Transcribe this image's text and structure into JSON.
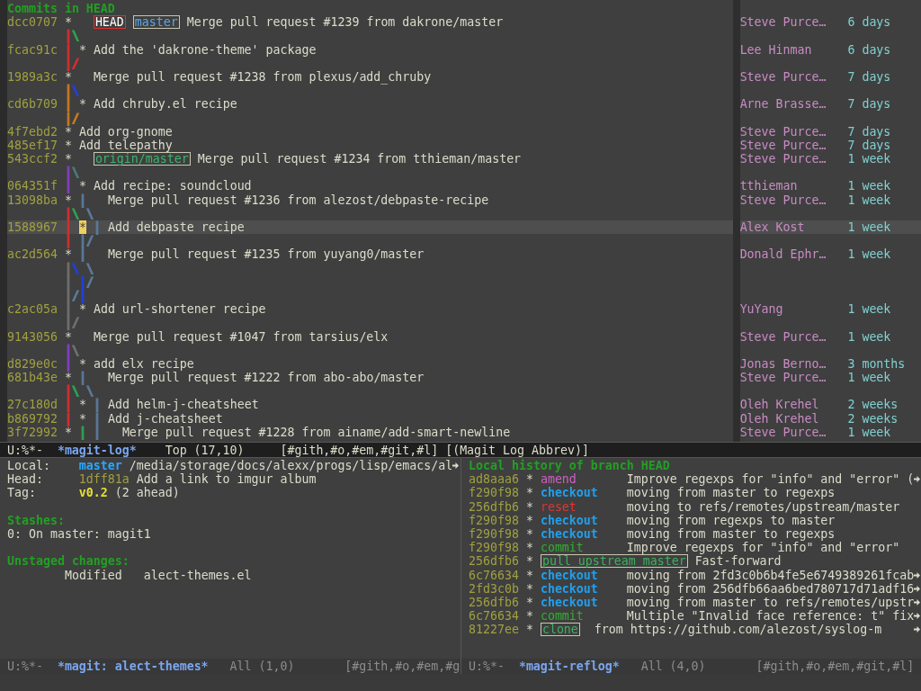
{
  "log": {
    "title": "Commits in HEAD",
    "rows": [
      {
        "kind": "commit",
        "hash": "dcc0707",
        "graph": [
          {
            "text": "*   "
          }
        ],
        "refs": [
          {
            "text": "HEAD",
            "kind": "head"
          },
          {
            "text": "master",
            "kind": "branch"
          }
        ],
        "message": "Merge pull request #1239 from dakrone/master",
        "author": "Steve Purce…",
        "date": "6 days",
        "selected": false
      },
      {
        "kind": "graph",
        "graph": [
          {
            "text": "|",
            "color": "#d03030"
          },
          {
            "text": "\\",
            "color": "#30a050"
          }
        ]
      },
      {
        "kind": "commit",
        "hash": "fcac91c",
        "graph": [
          {
            "text": "|",
            "color": "#d03030"
          },
          {
            "text": " * "
          }
        ],
        "message": "Add the 'dakrone-theme' package",
        "author": "Lee Hinman",
        "date": "6 days",
        "selected": false
      },
      {
        "kind": "graph",
        "graph": [
          {
            "text": "|",
            "color": "#d03030"
          },
          {
            "text": "/",
            "color": "#d03030"
          }
        ]
      },
      {
        "kind": "commit",
        "hash": "1989a3c",
        "graph": [
          {
            "text": "*   "
          }
        ],
        "message": "Merge pull request #1238 from plexus/add_chruby",
        "author": "Steve Purce…",
        "date": "7 days",
        "selected": false
      },
      {
        "kind": "graph",
        "graph": [
          {
            "text": "|",
            "color": "#c87820"
          },
          {
            "text": "\\",
            "color": "#2040e0"
          }
        ]
      },
      {
        "kind": "commit",
        "hash": "cd6b709",
        "graph": [
          {
            "text": "|",
            "color": "#c87820"
          },
          {
            "text": " * "
          }
        ],
        "message": "Add chruby.el recipe",
        "author": "Arne Brasse…",
        "date": "7 days",
        "selected": false
      },
      {
        "kind": "graph",
        "graph": [
          {
            "text": "|",
            "color": "#c87820"
          },
          {
            "text": "/",
            "color": "#c87820"
          }
        ]
      },
      {
        "kind": "commit",
        "hash": "4f7ebd2",
        "graph": [
          {
            "text": "* "
          }
        ],
        "message": "Add org-gnome",
        "author": "Steve Purce…",
        "date": "7 days",
        "selected": false
      },
      {
        "kind": "commit",
        "hash": "485ef17",
        "graph": [
          {
            "text": "* "
          }
        ],
        "message": "Add telepathy",
        "author": "Steve Purce…",
        "date": "7 days",
        "selected": false
      },
      {
        "kind": "commit",
        "hash": "543ccf2",
        "graph": [
          {
            "text": "*   "
          }
        ],
        "refs": [
          {
            "text": "origin/master",
            "kind": "remote"
          }
        ],
        "message": "Merge pull request #1234 from tthieman/master",
        "author": "Steve Purce…",
        "date": "1 week",
        "selected": false
      },
      {
        "kind": "graph",
        "graph": [
          {
            "text": "|",
            "color": "#8040c0"
          },
          {
            "text": "\\",
            "color": "#4a7a7a"
          }
        ]
      },
      {
        "kind": "commit",
        "hash": "064351f",
        "graph": [
          {
            "text": "|",
            "color": "#8040c0"
          },
          {
            "text": " * "
          }
        ],
        "message": "Add recipe: soundcloud",
        "author": "tthieman",
        "date": "1 week",
        "selected": false
      },
      {
        "kind": "commit",
        "hash": "13098ba",
        "graph": [
          {
            "text": "* "
          },
          {
            "text": "|   ",
            "color": "#5a7a9a"
          }
        ],
        "message": "Merge pull request #1236 from alezost/debpaste-recipe",
        "author": "Steve Purce…",
        "date": "1 week",
        "selected": false
      },
      {
        "kind": "graph",
        "graph": [
          {
            "text": "|",
            "color": "#d03030"
          },
          {
            "text": "\\ ",
            "color": "#30a050"
          },
          {
            "text": "\\",
            "color": "#5a7a9a"
          }
        ]
      },
      {
        "kind": "commit",
        "hash": "1588967",
        "graph": [
          {
            "text": "|",
            "color": "#d03030"
          },
          {
            "text": " * ",
            "cursor": true
          },
          {
            "text": "| ",
            "color": "#5a7a9a"
          }
        ],
        "message": "Add debpaste recipe",
        "author": "Alex Kost",
        "date": "1 week",
        "selected": true
      },
      {
        "kind": "graph",
        "graph": [
          {
            "text": "|",
            "color": "#d03030"
          },
          {
            "text": " |",
            "color": "#5a7a9a"
          },
          {
            "text": "/",
            "color": "#5a7a9a"
          }
        ]
      },
      {
        "kind": "commit",
        "hash": "ac2d564",
        "graph": [
          {
            "text": "* "
          },
          {
            "text": "|   ",
            "color": "#5a7a9a"
          }
        ],
        "message": "Merge pull request #1235 from yuyang0/master",
        "author": "Donald Ephr…",
        "date": "1 week",
        "selected": false
      },
      {
        "kind": "graph",
        "graph": [
          {
            "text": "|",
            "color": "#707070"
          },
          {
            "text": "\\ ",
            "color": "#2040e0"
          },
          {
            "text": "\\",
            "color": "#5a7a9a"
          }
        ]
      },
      {
        "kind": "graph",
        "graph": [
          {
            "text": "|",
            "color": "#707070"
          },
          {
            "text": " |",
            "color": "#2040e0"
          },
          {
            "text": "/",
            "color": "#5a7a9a"
          }
        ]
      },
      {
        "kind": "graph",
        "graph": [
          {
            "text": "|",
            "color": "#707070"
          },
          {
            "text": "/",
            "color": "#5a7a9a"
          },
          {
            "text": "|",
            "color": "#2040e0"
          }
        ]
      },
      {
        "kind": "commit",
        "hash": "c2ac05a",
        "graph": [
          {
            "text": "|",
            "color": "#707070"
          },
          {
            "text": " * "
          }
        ],
        "message": "Add url-shortener recipe",
        "author": "YuYang",
        "date": "1 week",
        "selected": false
      },
      {
        "kind": "graph",
        "graph": [
          {
            "text": "|",
            "color": "#707070"
          },
          {
            "text": "/",
            "color": "#707070"
          }
        ]
      },
      {
        "kind": "commit",
        "hash": "9143056",
        "graph": [
          {
            "text": "*   "
          }
        ],
        "message": "Merge pull request #1047 from tarsius/elx",
        "author": "Steve Purce…",
        "date": "1 week",
        "selected": false
      },
      {
        "kind": "graph",
        "graph": [
          {
            "text": "|",
            "color": "#8040c0"
          },
          {
            "text": "\\",
            "color": "#707070"
          }
        ]
      },
      {
        "kind": "commit",
        "hash": "d829e0c",
        "graph": [
          {
            "text": "|",
            "color": "#8040c0"
          },
          {
            "text": " * "
          }
        ],
        "message": "add elx recipe",
        "author": "Jonas Berno…",
        "date": "3 months",
        "selected": false
      },
      {
        "kind": "commit",
        "hash": "681b43e",
        "graph": [
          {
            "text": "* "
          },
          {
            "text": "|   ",
            "color": "#5a7a9a"
          }
        ],
        "message": "Merge pull request #1222 from abo-abo/master",
        "author": "Steve Purce…",
        "date": "1 week",
        "selected": false
      },
      {
        "kind": "graph",
        "graph": [
          {
            "text": "|",
            "color": "#d03030"
          },
          {
            "text": "\\ ",
            "color": "#30a050"
          },
          {
            "text": "\\",
            "color": "#5a7a9a"
          }
        ]
      },
      {
        "kind": "commit",
        "hash": "27c180d",
        "graph": [
          {
            "text": "|",
            "color": "#d03030"
          },
          {
            "text": " * "
          },
          {
            "text": "| ",
            "color": "#5a7a9a"
          }
        ],
        "message": "Add helm-j-cheatsheet",
        "author": "Oleh Krehel",
        "date": "2 weeks",
        "selected": false
      },
      {
        "kind": "commit",
        "hash": "b869792",
        "graph": [
          {
            "text": "|",
            "color": "#d03030"
          },
          {
            "text": " * "
          },
          {
            "text": "| ",
            "color": "#5a7a9a"
          }
        ],
        "message": "Add j-cheatsheet",
        "author": "Oleh Krehel",
        "date": "2 weeks",
        "selected": false
      },
      {
        "kind": "commit",
        "hash": "3f72992",
        "graph": [
          {
            "text": "* "
          },
          {
            "text": "| ",
            "color": "#30a050"
          },
          {
            "text": "|   ",
            "color": "#5a7a9a"
          }
        ],
        "message": "Merge pull request #1228 from ainame/add-smart-newline",
        "author": "Steve Purce…",
        "date": "1 week",
        "selected": false
      }
    ]
  },
  "log_mode_line": {
    "active": true,
    "segments": [
      {
        "text": "U:%*-",
        "kind": "flags"
      },
      {
        "text": "*magit-log*",
        "kind": "buffer"
      },
      {
        "text": "Top (17,10)",
        "kind": "position"
      },
      {
        "text": "[#gith,#o,#em,#git,#l]",
        "kind": "tags"
      },
      {
        "text": "[(Magit Log Abbrev)]",
        "kind": "mode"
      }
    ]
  },
  "status": {
    "fields": [
      {
        "label": "Local:",
        "value": [
          {
            "text": "master",
            "kind": "branch"
          },
          {
            "text": "/media/storage/docs/alexx/progs/lisp/emacs/al",
            "kind": "text"
          }
        ],
        "truncated": true
      },
      {
        "label": "Head:",
        "value": [
          {
            "text": "1dff81a",
            "kind": "hash"
          },
          {
            "text": "Add a link to imgur album",
            "kind": "text"
          }
        ],
        "truncated": false
      },
      {
        "label": "Tag:",
        "value": [
          {
            "text": "v0.2",
            "kind": "tag"
          },
          {
            "text": "(2 ahead)",
            "kind": "text"
          }
        ],
        "truncated": false
      }
    ],
    "sections": [
      {
        "title": "Stashes:",
        "items": [
          {
            "kind": "stash",
            "text": "0: On master: magit1"
          }
        ]
      },
      {
        "title": "Unstaged changes:",
        "items": [
          {
            "kind": "change",
            "status": "Modified",
            "file": "alect-themes.el"
          }
        ]
      }
    ]
  },
  "status_mode_line": {
    "active": false,
    "segments": [
      {
        "text": "U:%*-",
        "kind": "flags"
      },
      {
        "text": "*magit: alect-themes*",
        "kind": "buffer"
      },
      {
        "text": "All (1,0)",
        "kind": "position"
      },
      {
        "text": "[#gith,#o,#em,#g",
        "kind": "tags"
      }
    ]
  },
  "reflog": {
    "title": "Local history of branch HEAD",
    "rows": [
      {
        "hash": "ad8aaa6",
        "action": "amend",
        "kind": "amend",
        "message": "Improve regexps for \"info\" and \"error\" (",
        "truncated": true
      },
      {
        "hash": "f290f98",
        "action": "checkout",
        "kind": "checkout",
        "message": "moving from master to regexps",
        "truncated": false
      },
      {
        "hash": "256dfb6",
        "action": "reset",
        "kind": "reset",
        "message": "moving to refs/remotes/upstream/master",
        "truncated": false
      },
      {
        "hash": "f290f98",
        "action": "checkout",
        "kind": "checkout",
        "message": "moving from regexps to master",
        "truncated": false
      },
      {
        "hash": "f290f98",
        "action": "checkout",
        "kind": "checkout",
        "message": "moving from master to regexps",
        "truncated": false
      },
      {
        "hash": "f290f98",
        "action": "commit",
        "kind": "commit",
        "message": "Improve regexps for \"info\" and \"error\"",
        "truncated": false
      },
      {
        "hash": "256dfb6",
        "action": "pull upstream master",
        "kind": "pull",
        "message": "Fast-forward",
        "truncated": false
      },
      {
        "hash": "6c76634",
        "action": "checkout",
        "kind": "checkout",
        "message": "moving from 2fd3c0b6b4fe5e6749389261fcab",
        "truncated": true
      },
      {
        "hash": "2fd3c0b",
        "action": "checkout",
        "kind": "checkout",
        "message": "moving from 256dfb66aa6bed780717d71adf16",
        "truncated": true
      },
      {
        "hash": "256dfb6",
        "action": "checkout",
        "kind": "checkout",
        "message": "moving from master to refs/remotes/upstr",
        "truncated": true
      },
      {
        "hash": "6c76634",
        "action": "commit",
        "kind": "commit",
        "message": "Multiple \"Invalid face reference: t\" fix",
        "truncated": true
      },
      {
        "hash": "81227ee",
        "action": "clone",
        "kind": "clone",
        "message": "from https://github.com/alezost/syslog-m",
        "truncated": true
      }
    ]
  },
  "reflog_mode_line": {
    "active": false,
    "segments": [
      {
        "text": "U:%*-",
        "kind": "flags"
      },
      {
        "text": "*magit-reflog*",
        "kind": "buffer"
      },
      {
        "text": "All (4,0)",
        "kind": "position"
      },
      {
        "text": "[#gith,#o,#em,#git,#l]",
        "kind": "tags"
      }
    ]
  }
}
